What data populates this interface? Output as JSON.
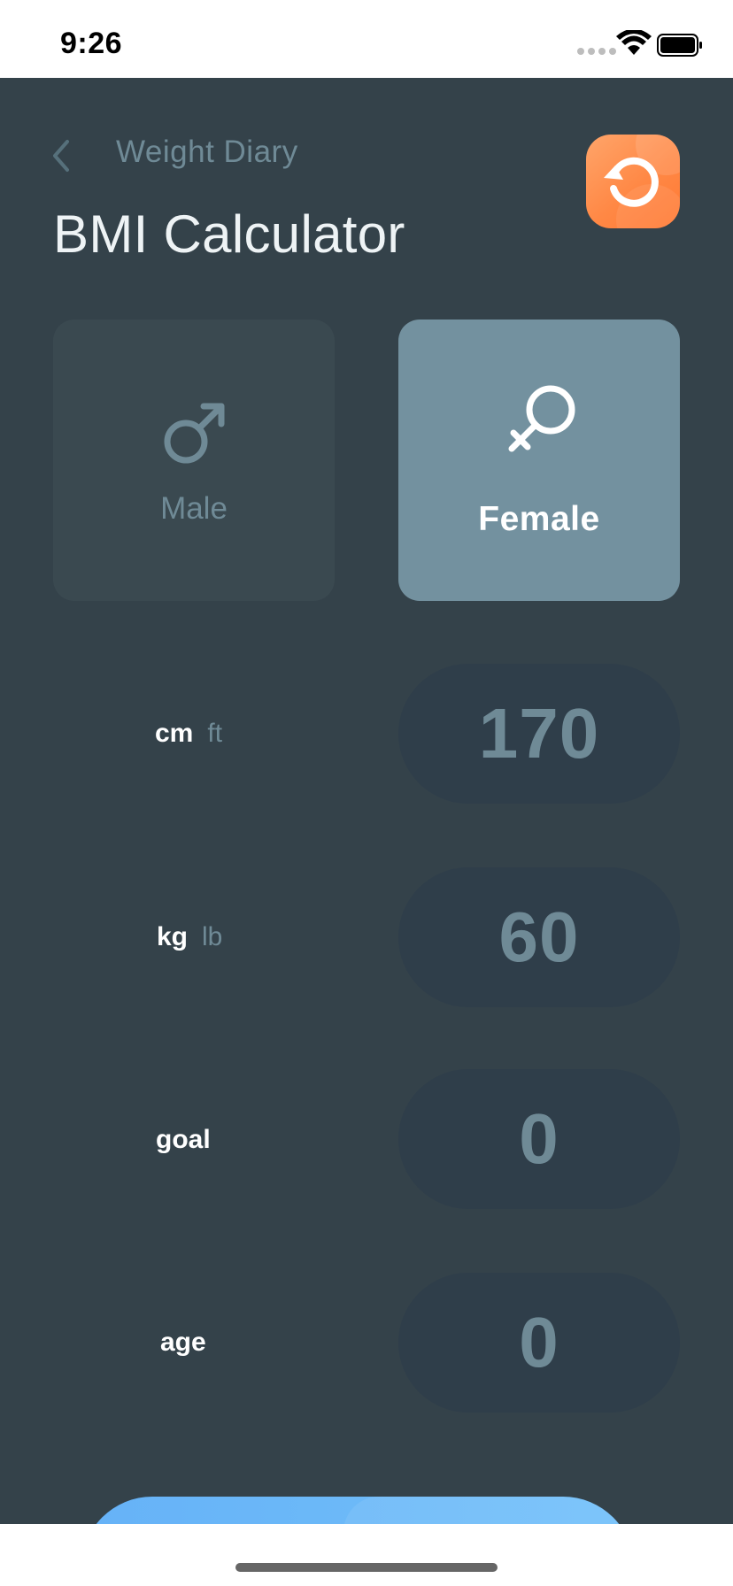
{
  "status_bar": {
    "time": "9:26",
    "icons": [
      "signal-dots-icon",
      "wifi-icon",
      "battery-icon"
    ]
  },
  "nav": {
    "back_icon": "chevron-left-icon",
    "title": "Weight Diary",
    "reset_icon": "refresh-icon"
  },
  "page_title": "BMI Calculator",
  "gender": {
    "selected": "Female",
    "male": {
      "label": "Male",
      "icon": "male-symbol-icon"
    },
    "female": {
      "label": "Female",
      "icon": "female-symbol-icon"
    }
  },
  "rows": [
    {
      "name": "height",
      "unit_active": "cm",
      "unit_inactive": "ft",
      "value": "170"
    },
    {
      "name": "weight",
      "unit_active": "kg",
      "unit_inactive": "lb",
      "value": "60"
    },
    {
      "name": "goal",
      "label": "goal",
      "value": "0"
    },
    {
      "name": "age",
      "label": "age",
      "value": "0"
    }
  ],
  "colors": {
    "background": "#34424a",
    "accent_orange": "#ff8845",
    "selected_card": "#73919f",
    "primary_button": "#66b2f7"
  }
}
